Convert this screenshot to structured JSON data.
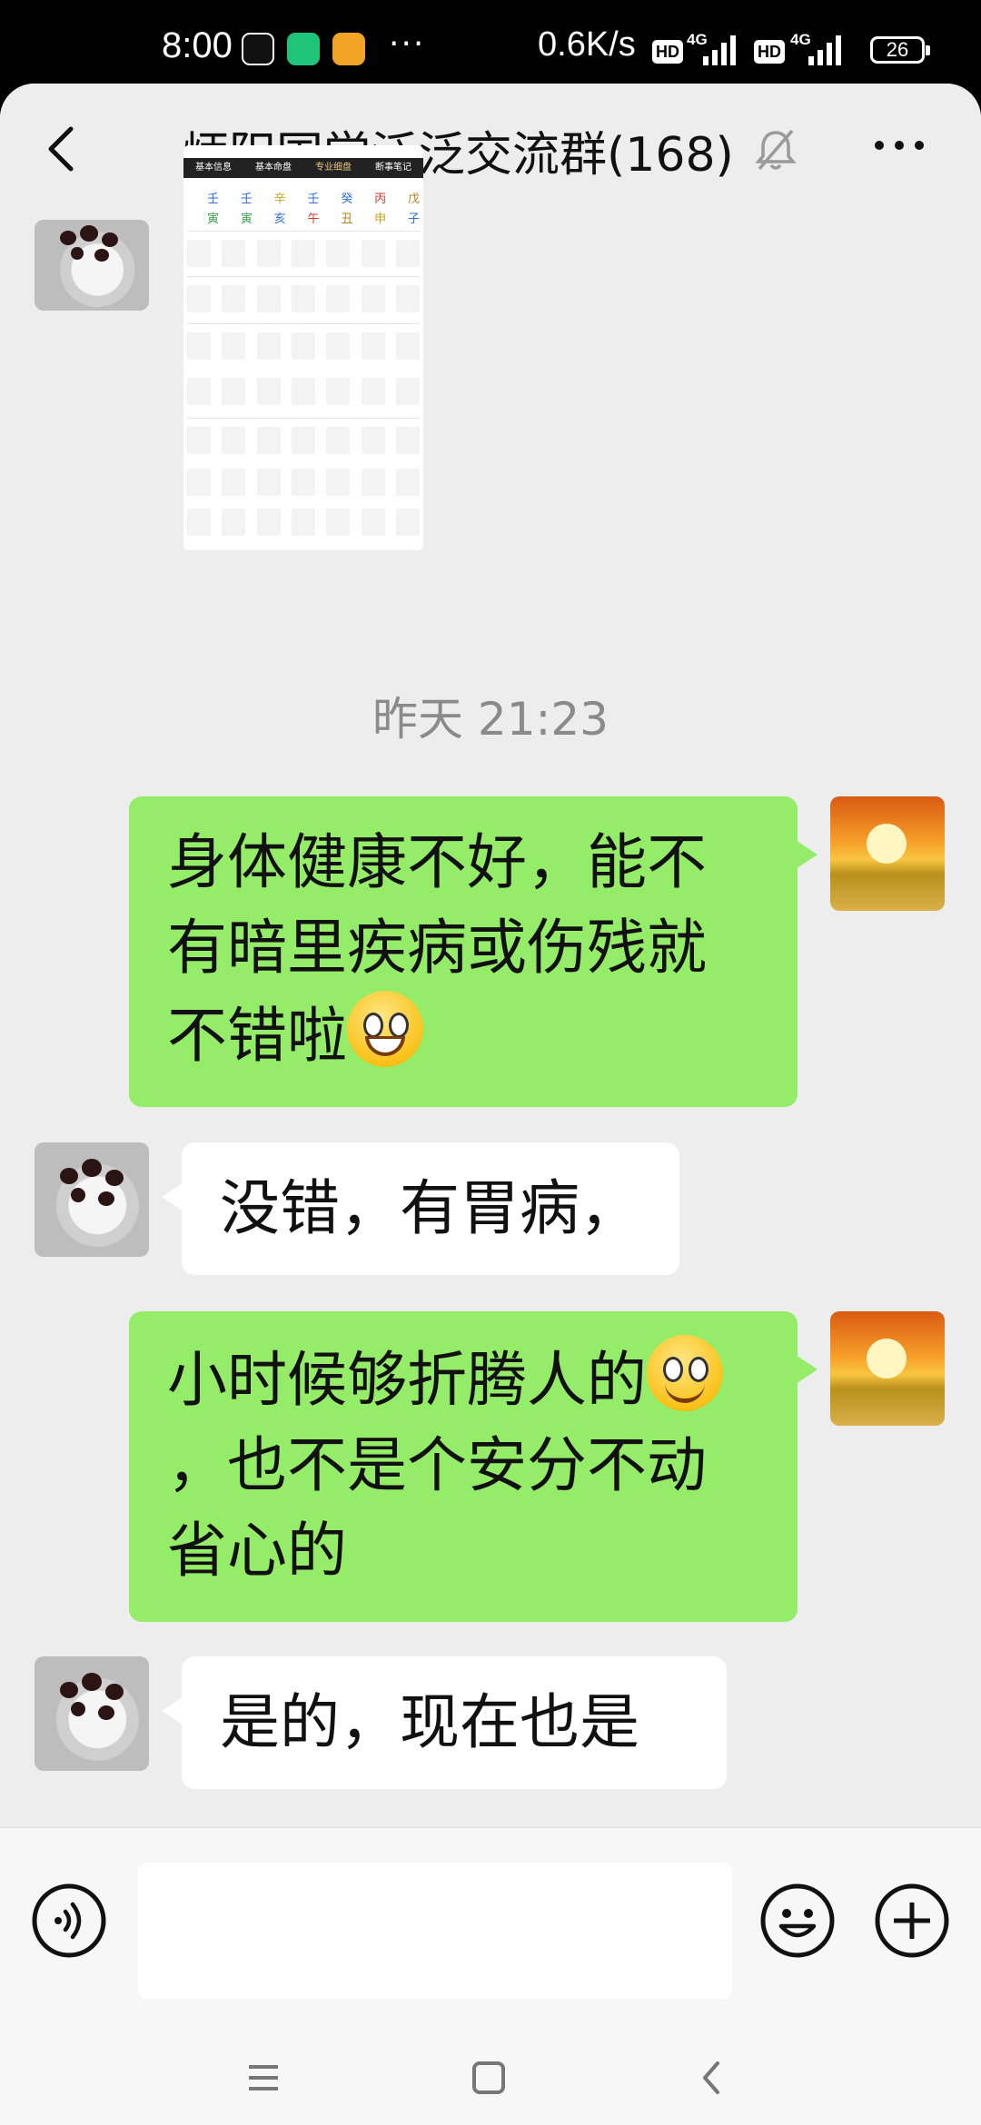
{
  "status_bar": {
    "time": "8:00",
    "more": "···",
    "net_speed": "0.6K/s",
    "hd": "HD",
    "net_type": "4G",
    "battery": "26"
  },
  "header": {
    "title": "炳阳国学泛泛交流群(168)",
    "icons": [
      "back-arrow-icon",
      "mute-bell-icon",
      "more-dots-icon"
    ]
  },
  "shared_image": {
    "tabs": [
      "基本信息",
      "基本命盘",
      "专业细盘",
      "断事笔记"
    ],
    "stems": [
      "壬",
      "壬",
      "辛",
      "壬",
      "癸",
      "丙",
      "戊"
    ],
    "branches": [
      "寅",
      "寅",
      "亥",
      "午",
      "丑",
      "申",
      "子"
    ]
  },
  "timestamp": "昨天 21:23",
  "messages": [
    {
      "side": "right",
      "text": "身体健康不好，能不有暗里疾病或伤残就不错啦",
      "emoji": "grinning-face"
    },
    {
      "side": "left",
      "text": "没错，有胃病，"
    },
    {
      "side": "right",
      "text_before": "小时候够折腾人的",
      "emoji": "smiling-face",
      "text_after": "，也不是个安分不动省心的"
    },
    {
      "side": "left",
      "text": "是的，现在也是"
    }
  ],
  "input_bar": {
    "value": "",
    "icons": [
      "voice-icon",
      "emoji-icon",
      "plus-icon"
    ]
  },
  "nav_bar": {
    "icons": [
      "menu-icon",
      "home-icon",
      "back-icon"
    ]
  },
  "colors": {
    "sent_bubble": "#95ec69",
    "received_bubble": "#ffffff",
    "chat_background": "#ededed"
  }
}
